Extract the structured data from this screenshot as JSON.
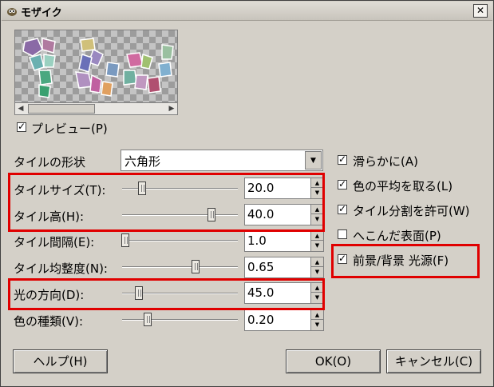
{
  "window": {
    "title": "モザイク",
    "close_label": "✕"
  },
  "preview": {
    "checkbox_label": "プレビュー(P)",
    "checked": true
  },
  "tile_shape": {
    "label": "タイルの形状",
    "value": "六角形"
  },
  "sliders": [
    {
      "label": "タイルサイズ(T):",
      "value": "20.0"
    },
    {
      "label": "タイル高(H):",
      "value": "40.0"
    },
    {
      "label": "タイル間隔(E):",
      "value": "1.0"
    },
    {
      "label": "タイル均整度(N):",
      "value": "0.65"
    },
    {
      "label": "光の方向(D):",
      "value": "45.0"
    },
    {
      "label": "色の種類(V):",
      "value": "0.20"
    }
  ],
  "options": [
    {
      "label": "滑らかに(A)",
      "checked": true
    },
    {
      "label": "色の平均を取る(L)",
      "checked": true
    },
    {
      "label": "タイル分割を許可(W)",
      "checked": true
    },
    {
      "label": "へこんだ表面(P)",
      "checked": false
    },
    {
      "label": "前景/背景 光源(F)",
      "checked": true
    }
  ],
  "buttons": {
    "help": "ヘルプ(H)",
    "ok": "OK(O)",
    "cancel": "キャンセル(C)"
  },
  "colors": {
    "highlight": "#e00000",
    "dialog_bg": "#d4d0c8"
  }
}
